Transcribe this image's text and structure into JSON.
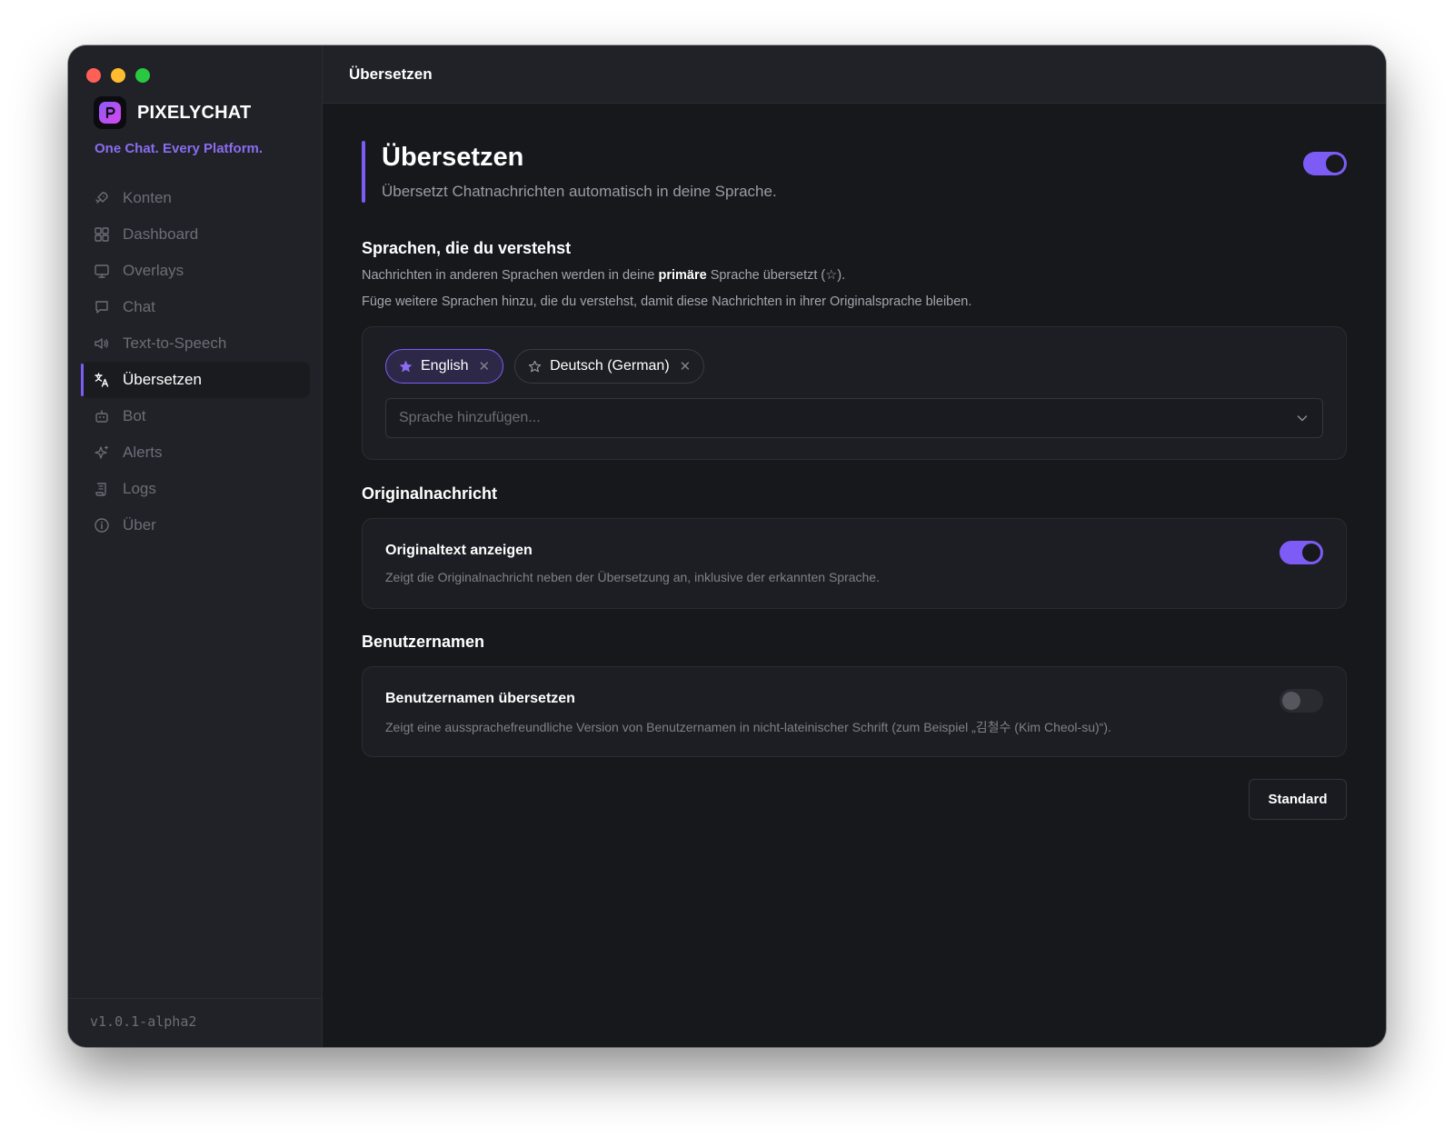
{
  "app": {
    "name": "PIXELYCHAT",
    "tagline": "One Chat. Every Platform.",
    "version": "v1.0.1-alpha2",
    "accent": "#7c5cf5"
  },
  "sidebar": {
    "items": [
      {
        "label": "Konten",
        "icon": "rocket-icon"
      },
      {
        "label": "Dashboard",
        "icon": "grid-icon"
      },
      {
        "label": "Overlays",
        "icon": "monitor-icon"
      },
      {
        "label": "Chat",
        "icon": "chat-bubble-icon"
      },
      {
        "label": "Text-to-Speech",
        "icon": "speaker-icon"
      },
      {
        "label": "Übersetzen",
        "icon": "translate-icon",
        "active": true
      },
      {
        "label": "Bot",
        "icon": "robot-icon"
      },
      {
        "label": "Alerts",
        "icon": "sparkle-icon"
      },
      {
        "label": "Logs",
        "icon": "scroll-icon"
      },
      {
        "label": "Über",
        "icon": "info-icon"
      }
    ]
  },
  "topbar": {
    "title": "Übersetzen"
  },
  "hero": {
    "title": "Übersetzen",
    "subtitle": "Übersetzt Chatnachrichten automatisch in deine Sprache.",
    "enabled": true
  },
  "languages": {
    "title": "Sprachen, die du verstehst",
    "line1_before": "Nachrichten in anderen Sprachen werden in deine ",
    "line1_bold": "primäre",
    "line1_after": " Sprache übersetzt (☆).",
    "line2": "Füge weitere Sprachen hinzu, die du verstehst, damit diese Nachrichten in ihrer Originalsprache bleiben.",
    "chips": [
      {
        "label": "English",
        "primary": true
      },
      {
        "label": "Deutsch (German)",
        "primary": false
      }
    ],
    "remove_glyph": "✕",
    "add_placeholder": "Sprache hinzufügen..."
  },
  "original": {
    "section_title": "Originalnachricht",
    "option_title": "Originaltext anzeigen",
    "option_desc": "Zeigt die Originalnachricht neben der Übersetzung an, inklusive der erkannten Sprache.",
    "enabled": true
  },
  "usernames": {
    "section_title": "Benutzernamen",
    "option_title": "Benutzernamen übersetzen",
    "option_desc": "Zeigt eine aussprachefreundliche Version von Benutzernamen in nicht-lateinischer Schrift (zum Beispiel „김철수 (Kim Cheol-su)“).",
    "enabled": false
  },
  "footer": {
    "reset_label": "Standard"
  }
}
